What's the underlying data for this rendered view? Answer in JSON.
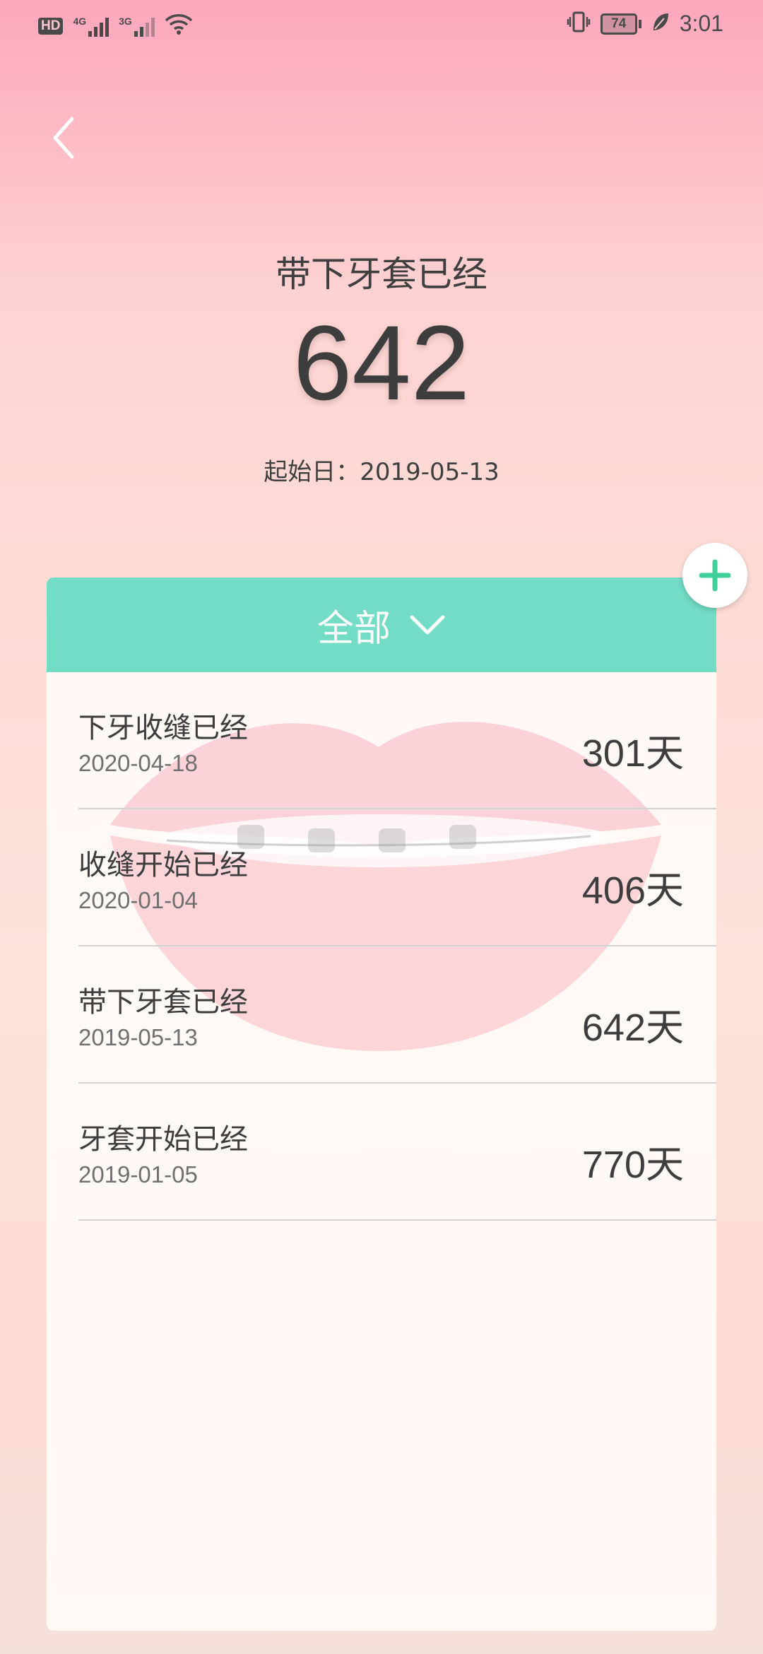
{
  "status_bar": {
    "hd_label": "HD",
    "net1_label": "4G",
    "net2_label": "3G",
    "battery_level": "74",
    "time": "3:01",
    "icons": [
      "wifi-icon",
      "vibrate-icon",
      "battery-icon",
      "leaf-icon"
    ]
  },
  "header": {
    "title": "带下牙套已经",
    "count": "642",
    "start_date": "起始日：2019-05-13"
  },
  "filter": {
    "label": "全部"
  },
  "items": [
    {
      "title": "下牙收缝已经",
      "date": "2020-04-18",
      "days": "301天"
    },
    {
      "title": "收缝开始已经",
      "date": "2020-01-04",
      "days": "406天"
    },
    {
      "title": "带下牙套已经",
      "date": "2019-05-13",
      "days": "642天"
    },
    {
      "title": "牙套开始已经",
      "date": "2019-01-05",
      "days": "770天"
    }
  ],
  "colors": {
    "accent": "#73dcc4",
    "add_icon": "#3ecf9a",
    "text": "#3d3d3d"
  }
}
